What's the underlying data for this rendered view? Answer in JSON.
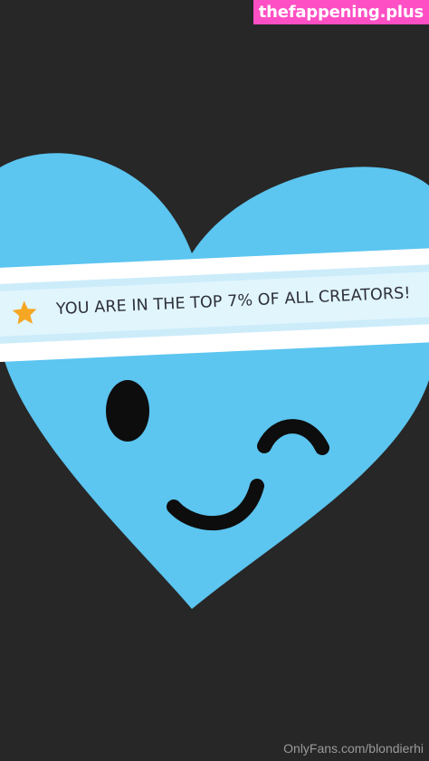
{
  "watermark": {
    "site": "thefappening.plus",
    "credit": "OnlyFans.com/blondierhi"
  },
  "banner": {
    "text": "YOU ARE IN THE TOP 7% OF ALL CREATORS!",
    "icon": "star-icon"
  },
  "colors": {
    "background": "#272727",
    "heart": "#5cc5f0",
    "face": "#0d0d0d",
    "star": "#f5a623",
    "watermark_bg": "#ff4fc4"
  }
}
